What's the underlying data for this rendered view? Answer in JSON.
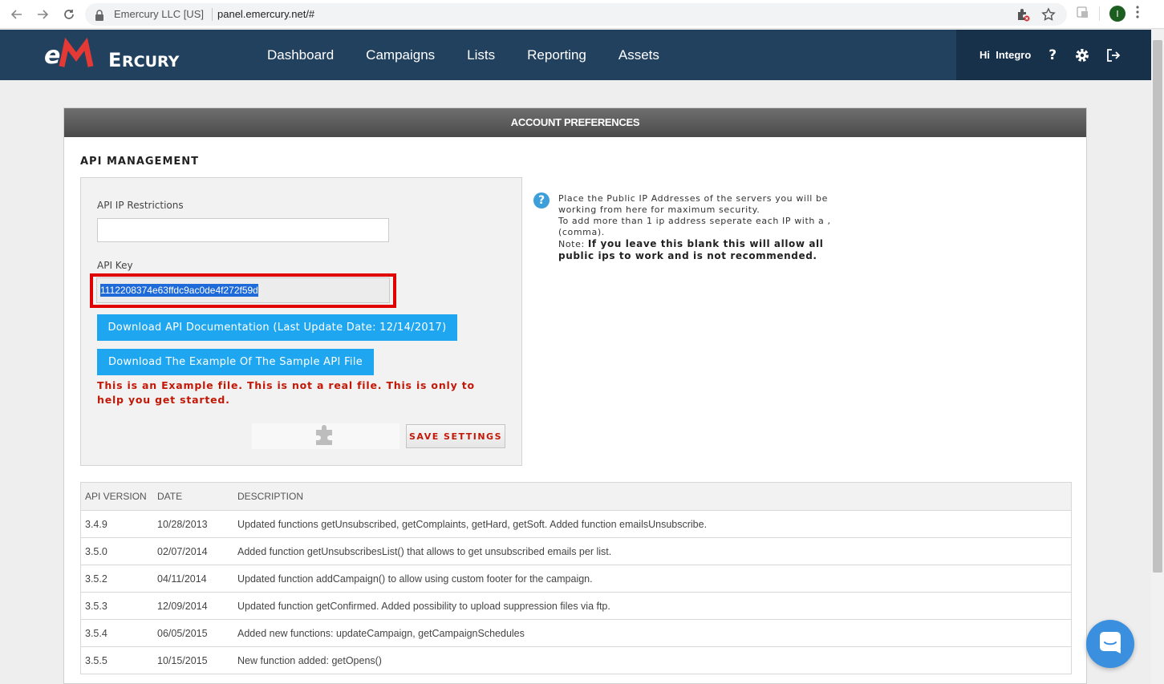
{
  "browser": {
    "site_name": "Emercury LLC [US]",
    "url": "panel.emercury.net/#",
    "profile_initial": "I"
  },
  "header": {
    "logo_text": "eMERCURY",
    "nav": [
      "Dashboard",
      "Campaigns",
      "Lists",
      "Reporting",
      "Assets"
    ],
    "greeting": "Hi  Integro",
    "help_label": "?"
  },
  "panel": {
    "title": "ACCOUNT PREFERENCES",
    "section_title": "API MANAGEMENT",
    "ip_label": "API IP Restrictions",
    "ip_value": "",
    "key_label": "API Key",
    "key_value": "1112208374e63ffdc9ac0de4f272f59d",
    "doc_button": "Download API Documentation (Last Update Date: 12/14/2017)",
    "example_button": "Download The Example Of The Sample API File",
    "warning": "This is an Example file. This is not a real file. This is only to help you get started.",
    "save_button": "SAVE SETTINGS",
    "help_line1": "Place the Public IP Addresses of the servers you will be working from here for maximum security.",
    "help_line2": "To add more than 1 ip address seperate each IP with a , (comma).",
    "help_note_label": "Note:",
    "help_note": "If you leave this blank this will allow all public ips to work and is not recommended."
  },
  "table": {
    "headers": [
      "API VERSION",
      "DATE",
      "DESCRIPTION"
    ],
    "rows": [
      [
        "3.4.9",
        "10/28/2013",
        "Updated functions getUnsubscribed, getComplaints, getHard, getSoft. Added function emailsUnsubscribe."
      ],
      [
        "3.5.0",
        "02/07/2014",
        "Added function getUnsubscribesList() that allows to get unsubscribed emails per list."
      ],
      [
        "3.5.2",
        "04/11/2014",
        "Updated function addCampaign() to allow using custom footer for the campaign."
      ],
      [
        "3.5.3",
        "12/09/2014",
        "Updated function getConfirmed. Added possibility to upload suppression files via ftp."
      ],
      [
        "3.5.4",
        "06/05/2015",
        "Added new functions: updateCampaign, getCampaignSchedules"
      ],
      [
        "3.5.5",
        "10/15/2015",
        "New function added: getOpens()"
      ]
    ]
  },
  "colors": {
    "header_bg": "#21415f",
    "button_blue": "#1ea7f0",
    "warning_red": "#c21807",
    "highlight_red": "#e00000"
  }
}
